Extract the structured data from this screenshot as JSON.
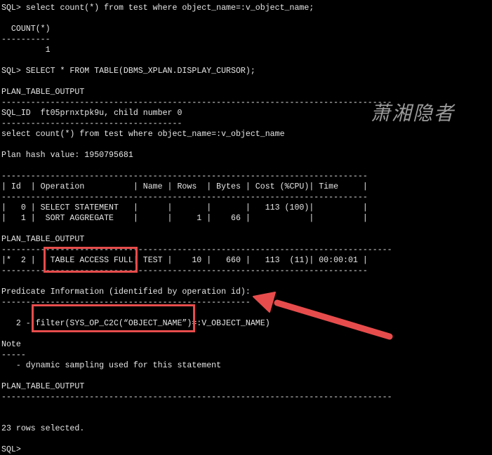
{
  "terminal": {
    "lines": [
      "SQL> select count(*) from test where object_name=:v_object_name;",
      "",
      "  COUNT(*)",
      "----------",
      "         1",
      "",
      "SQL> SELECT * FROM TABLE(DBMS_XPLAN.DISPLAY_CURSOR);",
      "",
      "PLAN_TABLE_OUTPUT",
      "--------------------------------------------------------------------------------",
      "SQL_ID  ft05prnxtpk9u, child number 0",
      "-------------------------------------",
      "select count(*) from test where object_name=:v_object_name",
      "",
      "Plan hash value: 1950795681",
      "",
      "---------------------------------------------------------------------------",
      "| Id  | Operation          | Name | Rows  | Bytes | Cost (%CPU)| Time     |",
      "---------------------------------------------------------------------------",
      "|   0 | SELECT STATEMENT   |      |       |       |   113 (100)|          |",
      "|   1 |  SORT AGGREGATE    |      |     1 |    66 |            |          |",
      "",
      "PLAN_TABLE_OUTPUT",
      "--------------------------------------------------------------------------------",
      "|*  2 |   TABLE ACCESS FULL| TEST |    10 |   660 |   113  (11)| 00:00:01 |",
      "---------------------------------------------------------------------------",
      "",
      "Predicate Information (identified by operation id):",
      "---------------------------------------------------",
      "",
      "   2 - filter(SYS_OP_C2C(“OBJECT_NAME”)=:V_OBJECT_NAME)",
      "",
      "Note",
      "-----",
      "   - dynamic sampling used for this statement",
      "",
      "PLAN_TABLE_OUTPUT",
      "--------------------------------------------------------------------------------",
      "",
      "",
      "23 rows selected.",
      "",
      "SQL> "
    ]
  },
  "watermark": {
    "text": "萧湘隐者"
  },
  "annotations": {
    "color": "#e74c4c",
    "boxes": [
      "table-access-full-highlight",
      "filter-predicate-highlight"
    ],
    "arrow_target": "predicate-information-heading"
  }
}
